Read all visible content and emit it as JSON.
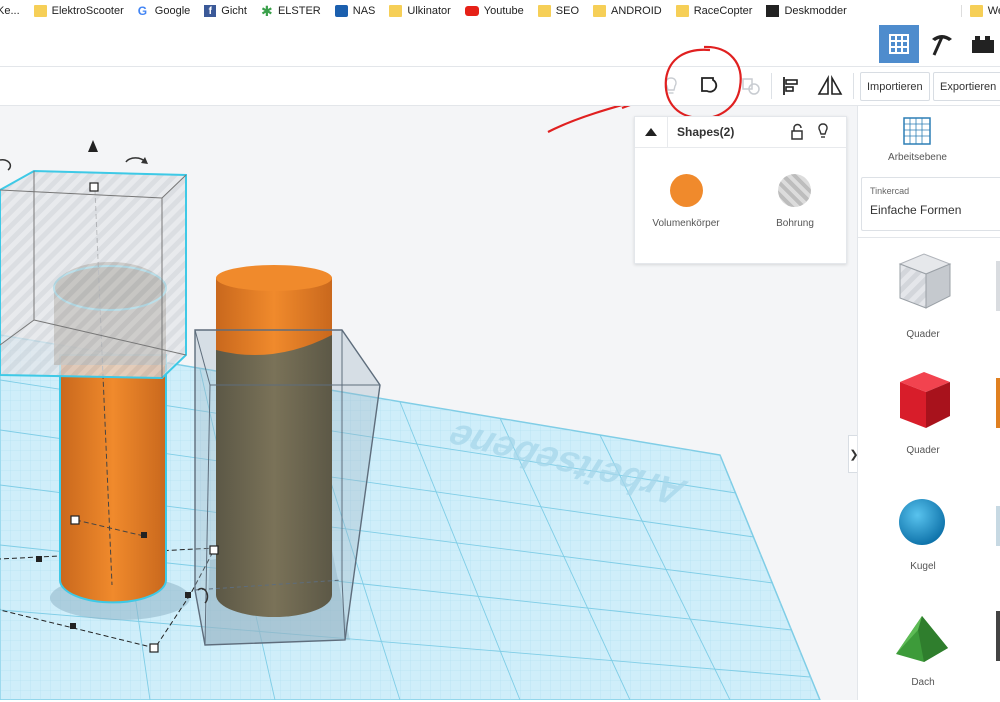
{
  "bookmarks": [
    {
      "label": "ElektroScooter",
      "icon": "folder-icon"
    },
    {
      "label": "Google",
      "icon": "google-icon"
    },
    {
      "label": "Gicht",
      "icon": "facebook-icon"
    },
    {
      "label": "ELSTER",
      "icon": "elster-icon"
    },
    {
      "label": "NAS",
      "icon": "nas-icon"
    },
    {
      "label": "Ulkinator",
      "icon": "folder-icon"
    },
    {
      "label": "Youtube",
      "icon": "youtube-icon"
    },
    {
      "label": "SEO",
      "icon": "folder-icon"
    },
    {
      "label": "ANDROID",
      "icon": "folder-icon"
    },
    {
      "label": "RaceCopter",
      "icon": "folder-icon"
    },
    {
      "label": "Deskmodder",
      "icon": "deskmodder-icon"
    }
  ],
  "bookmarks_cut_left": "Ke...",
  "bookmarks_cut_right": "We",
  "toolbar": {
    "import_label": "Importieren",
    "export_label": "Exportieren"
  },
  "inspector": {
    "title": "Shapes(2)",
    "solid_label": "Volumenkörper",
    "hole_label": "Bohrung"
  },
  "sidebar": {
    "workplane_label": "Arbeitsebene",
    "library_caption": "Tinkercad",
    "library_name": "Einfache Formen",
    "shapes": [
      {
        "label": "Quader",
        "icon": "striped-box-icon"
      },
      {
        "label": "Quader",
        "icon": "red-box-icon"
      },
      {
        "label": "Kugel",
        "icon": "blue-sphere-icon"
      },
      {
        "label": "Dach",
        "icon": "green-roof-icon"
      }
    ]
  },
  "workplane_watermark": "Arbeitsebene",
  "colors": {
    "accent": "#4e8ccd",
    "solid": "#f08a2c",
    "annotation": "#e02020",
    "grid": "#8fd3ea"
  }
}
